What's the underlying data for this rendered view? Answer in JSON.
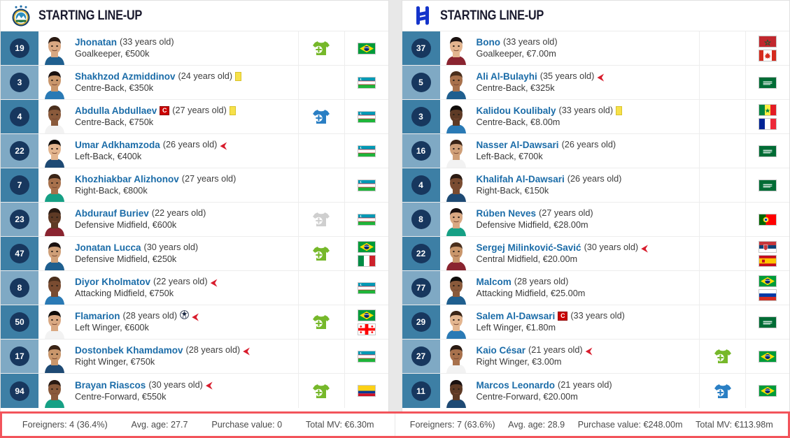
{
  "teams": [
    {
      "id": "home",
      "title": "STARTING LINE-UP",
      "logo_name": "pakhtakor-crest-icon",
      "players": [
        {
          "number": "19",
          "name": "Jhonatan",
          "age": "(33 years old)",
          "position_value": "Goalkeeper, €500k",
          "captain": false,
          "yellow_card": false,
          "goal": false,
          "sub_off": false,
          "sub_icon": "sub-on-green",
          "flags": [
            "brazil"
          ]
        },
        {
          "number": "3",
          "name": "Shakhzod Azmiddinov",
          "age": "(24 years old)",
          "position_value": "Centre-Back, €350k",
          "captain": false,
          "yellow_card": true,
          "goal": false,
          "sub_off": false,
          "sub_icon": null,
          "flags": [
            "uzbekistan"
          ]
        },
        {
          "number": "4",
          "name": "Abdulla Abdullaev",
          "age": "(27 years old)",
          "position_value": "Centre-Back, €750k",
          "captain": true,
          "yellow_card": true,
          "goal": false,
          "sub_off": false,
          "sub_icon": "sub-on-blue",
          "flags": [
            "uzbekistan"
          ]
        },
        {
          "number": "22",
          "name": "Umar Adkhamzoda",
          "age": "(26 years old)",
          "position_value": "Left-Back, €400k",
          "captain": false,
          "yellow_card": false,
          "goal": false,
          "sub_off": true,
          "sub_icon": null,
          "flags": [
            "uzbekistan"
          ]
        },
        {
          "number": "7",
          "name": "Khozhiakbar Alizhonov",
          "age": "(27 years old)",
          "position_value": "Right-Back, €800k",
          "captain": false,
          "yellow_card": false,
          "goal": false,
          "sub_off": false,
          "sub_icon": null,
          "flags": [
            "uzbekistan"
          ]
        },
        {
          "number": "23",
          "name": "Abdurauf Buriev",
          "age": "(22 years old)",
          "position_value": "Defensive Midfield, €600k",
          "captain": false,
          "yellow_card": false,
          "goal": false,
          "sub_off": false,
          "sub_icon": "sub-on-grey",
          "flags": [
            "uzbekistan"
          ]
        },
        {
          "number": "47",
          "name": "Jonatan Lucca",
          "age": "(30 years old)",
          "position_value": "Defensive Midfield, €250k",
          "captain": false,
          "yellow_card": false,
          "goal": false,
          "sub_off": false,
          "sub_icon": "sub-on-green",
          "flags": [
            "brazil",
            "italy"
          ]
        },
        {
          "number": "8",
          "name": "Diyor Kholmatov",
          "age": "(22 years old)",
          "position_value": "Attacking Midfield, €750k",
          "captain": false,
          "yellow_card": false,
          "goal": false,
          "sub_off": true,
          "sub_icon": null,
          "flags": [
            "uzbekistan"
          ]
        },
        {
          "number": "50",
          "name": "Flamarion",
          "age": "(28 years old)",
          "position_value": "Left Winger, €600k",
          "captain": false,
          "yellow_card": false,
          "goal": true,
          "sub_off": true,
          "sub_icon": "sub-on-green",
          "flags": [
            "brazil",
            "georgia"
          ]
        },
        {
          "number": "17",
          "name": "Dostonbek Khamdamov",
          "age": "(28 years old)",
          "position_value": "Right Winger, €750k",
          "captain": false,
          "yellow_card": false,
          "goal": false,
          "sub_off": true,
          "sub_icon": null,
          "flags": [
            "uzbekistan"
          ]
        },
        {
          "number": "94",
          "name": "Brayan Riascos",
          "age": "(30 years old)",
          "position_value": "Centre-Forward, €550k",
          "captain": false,
          "yellow_card": false,
          "goal": false,
          "sub_off": true,
          "sub_icon": "sub-on-green",
          "flags": [
            "colombia"
          ]
        }
      ],
      "footer": {
        "foreigners": "Foreigners: 4 (36.4%)",
        "avg_age": "Avg. age: 27.7",
        "purchase_value": "Purchase value: 0",
        "total_mv": "Total MV: €6.30m"
      }
    },
    {
      "id": "away",
      "title": "STARTING LINE-UP",
      "logo_name": "al-hilal-crest-icon",
      "players": [
        {
          "number": "37",
          "name": "Bono",
          "age": "(33 years old)",
          "position_value": "Goalkeeper, €7.00m",
          "captain": false,
          "yellow_card": false,
          "goal": false,
          "sub_off": false,
          "sub_icon": null,
          "flags": [
            "morocco",
            "canada"
          ]
        },
        {
          "number": "5",
          "name": "Ali Al-Bulayhi",
          "age": "(35 years old)",
          "position_value": "Centre-Back, €325k",
          "captain": false,
          "yellow_card": false,
          "goal": false,
          "sub_off": true,
          "sub_icon": null,
          "flags": [
            "saudi-arabia"
          ]
        },
        {
          "number": "3",
          "name": "Kalidou Koulibaly",
          "age": "(33 years old)",
          "position_value": "Centre-Back, €8.00m",
          "captain": false,
          "yellow_card": true,
          "goal": false,
          "sub_off": false,
          "sub_icon": null,
          "flags": [
            "senegal",
            "france"
          ]
        },
        {
          "number": "16",
          "name": "Nasser Al-Dawsari",
          "age": "(26 years old)",
          "position_value": "Left-Back, €700k",
          "captain": false,
          "yellow_card": false,
          "goal": false,
          "sub_off": false,
          "sub_icon": null,
          "flags": [
            "saudi-arabia"
          ]
        },
        {
          "number": "4",
          "name": "Khalifah Al-Dawsari",
          "age": "(26 years old)",
          "position_value": "Right-Back, €150k",
          "captain": false,
          "yellow_card": false,
          "goal": false,
          "sub_off": false,
          "sub_icon": null,
          "flags": [
            "saudi-arabia"
          ]
        },
        {
          "number": "8",
          "name": "Rúben Neves",
          "age": "(27 years old)",
          "position_value": "Defensive Midfield, €28.00m",
          "captain": false,
          "yellow_card": false,
          "goal": false,
          "sub_off": false,
          "sub_icon": null,
          "flags": [
            "portugal"
          ]
        },
        {
          "number": "22",
          "name": "Sergej Milinković-Savić",
          "age": "(30 years old)",
          "position_value": "Central Midfield, €20.00m",
          "captain": false,
          "yellow_card": false,
          "goal": false,
          "sub_off": true,
          "sub_icon": null,
          "flags": [
            "serbia",
            "spain"
          ]
        },
        {
          "number": "77",
          "name": "Malcom",
          "age": "(28 years old)",
          "position_value": "Attacking Midfield, €25.00m",
          "captain": false,
          "yellow_card": false,
          "goal": false,
          "sub_off": false,
          "sub_icon": null,
          "flags": [
            "brazil",
            "russia"
          ]
        },
        {
          "number": "29",
          "name": "Salem Al-Dawsari",
          "age": "(33 years old)",
          "position_value": "Left Winger, €1.80m",
          "captain": true,
          "yellow_card": false,
          "goal": false,
          "sub_off": false,
          "sub_icon": null,
          "flags": [
            "saudi-arabia"
          ]
        },
        {
          "number": "27",
          "name": "Kaio César",
          "age": "(21 years old)",
          "position_value": "Right Winger, €3.00m",
          "captain": false,
          "yellow_card": false,
          "goal": false,
          "sub_off": true,
          "sub_icon": "sub-on-green",
          "flags": [
            "brazil"
          ]
        },
        {
          "number": "11",
          "name": "Marcos Leonardo",
          "age": "(21 years old)",
          "position_value": "Centre-Forward, €20.00m",
          "captain": false,
          "yellow_card": false,
          "goal": false,
          "sub_off": false,
          "sub_icon": "sub-on-blue",
          "flags": [
            "brazil"
          ]
        }
      ],
      "footer": {
        "foreigners": "Foreigners: 7 (63.6%)",
        "avg_age": "Avg. age: 28.9",
        "purchase_value": "Purchase value: €248.00m",
        "total_mv": "Total MV: €113.98m"
      }
    }
  ],
  "colors": {
    "number_cell_dark": "#3d7fa5",
    "number_cell_light": "#7fa9c4",
    "number_badge": "#17375e",
    "player_link": "#1b6ca8",
    "footer_border": "#f2545b",
    "sub_on_green": "#76b82a",
    "sub_on_blue": "#2a7fc4",
    "sub_on_grey": "#cfcfcf",
    "arrow_off": "#d81c2c",
    "yellow_card": "#f7e14a",
    "captain_badge": "#cc0000"
  }
}
